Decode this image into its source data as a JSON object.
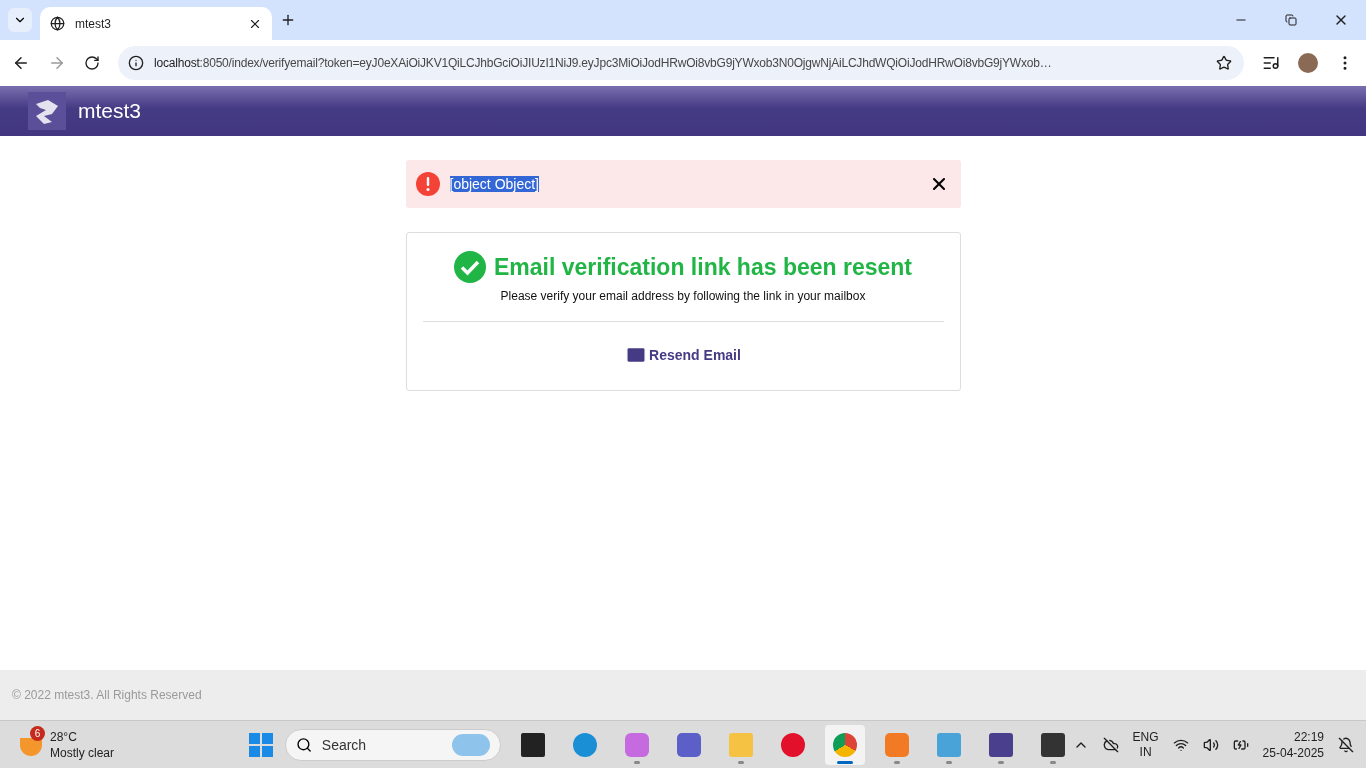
{
  "browser": {
    "tab": {
      "title": "mtest3",
      "selected": true
    },
    "url_host": "localhost",
    "url_rest": ":8050/index/verifyemail?token=eyJ0eXAiOiJKV1QiLCJhbGciOiJIUzI1NiJ9.eyJpc3MiOiJodHRwOi8vbG9jYWxob3N0OjgwNjAiLCJhdWQiOiJodHRwOi8vbG9jYWxob…"
  },
  "header": {
    "brand": "mtest3"
  },
  "alert": {
    "message": "[object Object]",
    "highlighted": true
  },
  "card": {
    "title": "Email verification link has been resent",
    "subtitle": "Please verify your email address by following the link in your mailbox",
    "action": "Resend Email"
  },
  "footer": {
    "text": "© 2022 mtest3. All Rights Reserved"
  },
  "taskbar": {
    "weather": {
      "temp": "28°C",
      "condition": "Mostly clear",
      "badge": "6"
    },
    "search": {
      "placeholder": "Search"
    },
    "apps": [
      {
        "kind": "taskview",
        "running": false,
        "selected": false
      },
      {
        "kind": "edge",
        "running": false,
        "selected": false
      },
      {
        "kind": "copilot",
        "running": true,
        "selected": false
      },
      {
        "kind": "teams",
        "running": false,
        "selected": false
      },
      {
        "kind": "files",
        "running": true,
        "selected": false
      },
      {
        "kind": "opera",
        "running": false,
        "selected": false
      },
      {
        "kind": "chrome",
        "running": true,
        "selected": true
      },
      {
        "kind": "xampp",
        "running": true,
        "selected": false
      },
      {
        "kind": "notepad",
        "running": true,
        "selected": false
      },
      {
        "kind": "brand",
        "running": true,
        "selected": false
      },
      {
        "kind": "terminal",
        "running": true,
        "selected": false
      }
    ],
    "language": [
      "ENG",
      "IN"
    ],
    "time": "22:19",
    "date": "25-04-2025"
  }
}
